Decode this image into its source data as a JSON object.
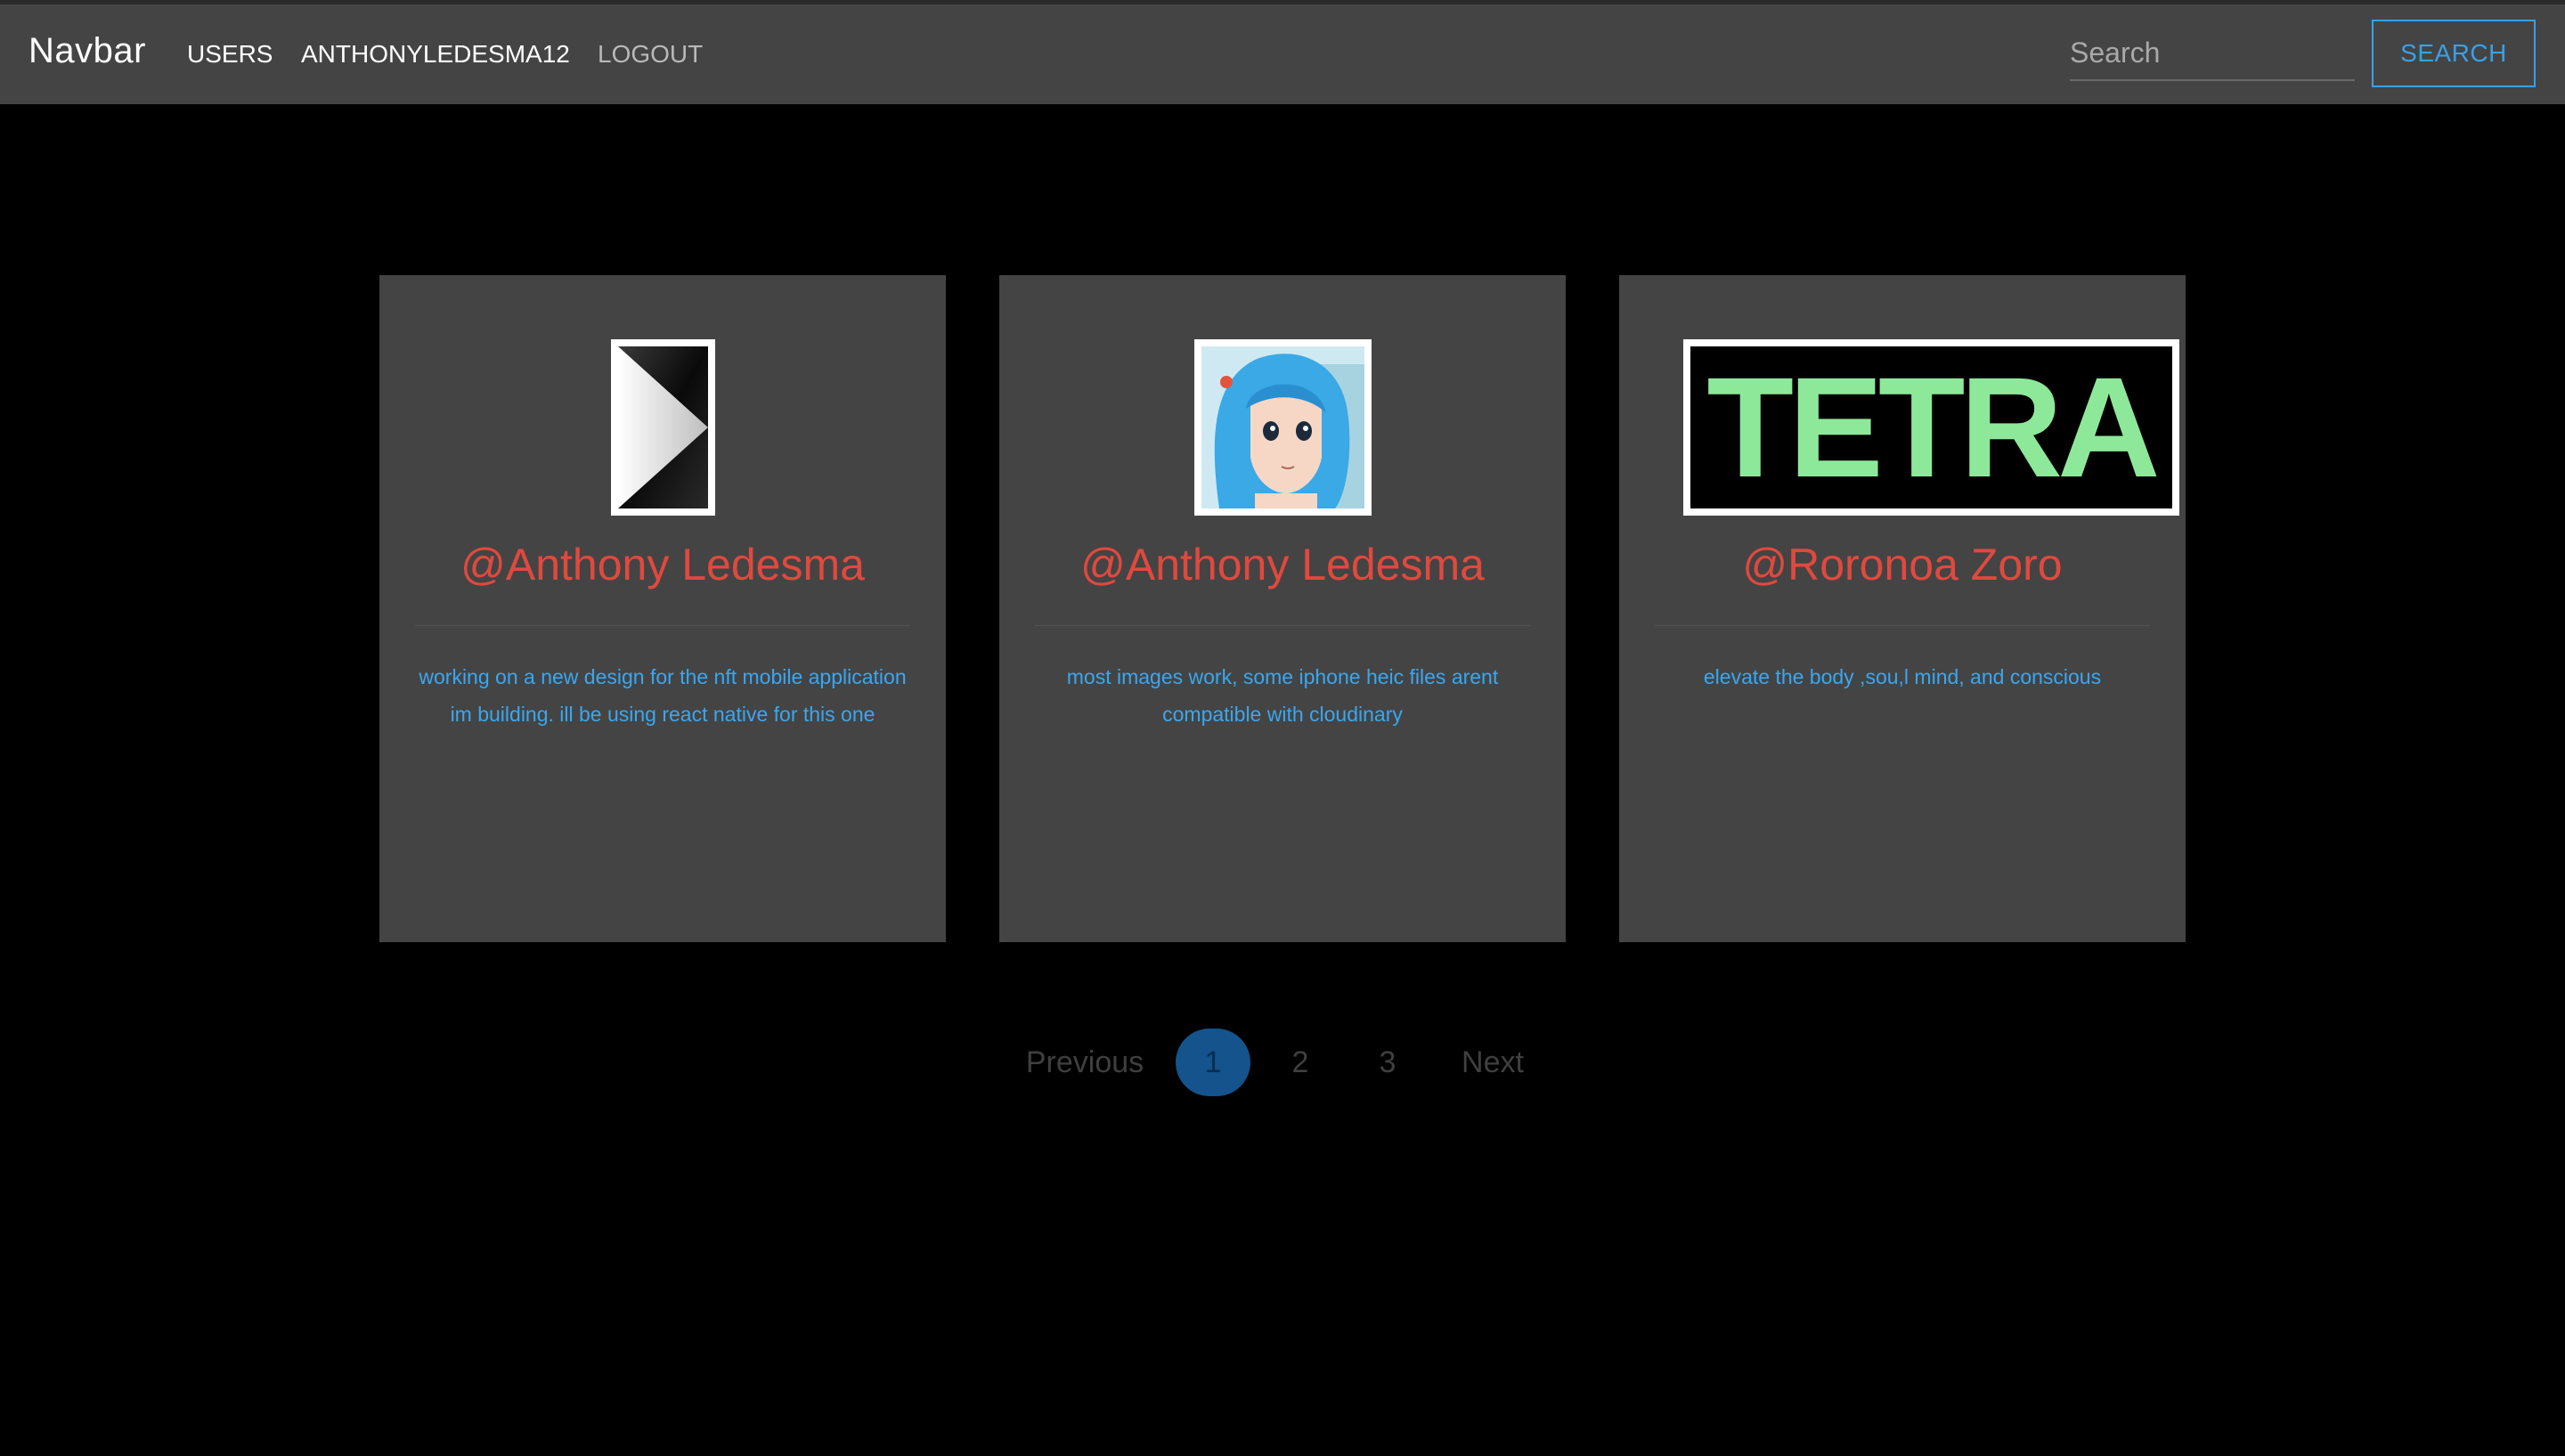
{
  "navbar": {
    "brand": "Navbar",
    "links": [
      {
        "label": "USERS"
      },
      {
        "label": "ANTHONYLEDESMA12"
      },
      {
        "label": "LOGOUT"
      }
    ],
    "search": {
      "placeholder": "Search",
      "value": "",
      "button_label": "SEARCH"
    }
  },
  "cards": [
    {
      "username": "@Anthony Ledesma",
      "bio": "working on a new design for the nft mobile application im building. ill be using react native for this one",
      "avatar": "play-arrow-logo"
    },
    {
      "username": "@Anthony Ledesma",
      "bio": "most images work, some iphone heic files arent compatible with cloudinary",
      "avatar": "anime-girl-blue-hair"
    },
    {
      "username": "@Roronoa Zoro",
      "bio": "elevate the body ,sou,l mind, and conscious",
      "avatar": "tetra-logo",
      "avatar_text": "TETRA"
    }
  ],
  "pagination": {
    "previous": "Previous",
    "pages": [
      "1",
      "2",
      "3"
    ],
    "current": "1",
    "next": "Next"
  },
  "colors": {
    "navbar_bg": "#444444",
    "card_bg": "#444444",
    "username": "#e0493e",
    "bio": "#3aa7f0",
    "accent": "#3aa0e6",
    "active_page": "#14538c"
  }
}
